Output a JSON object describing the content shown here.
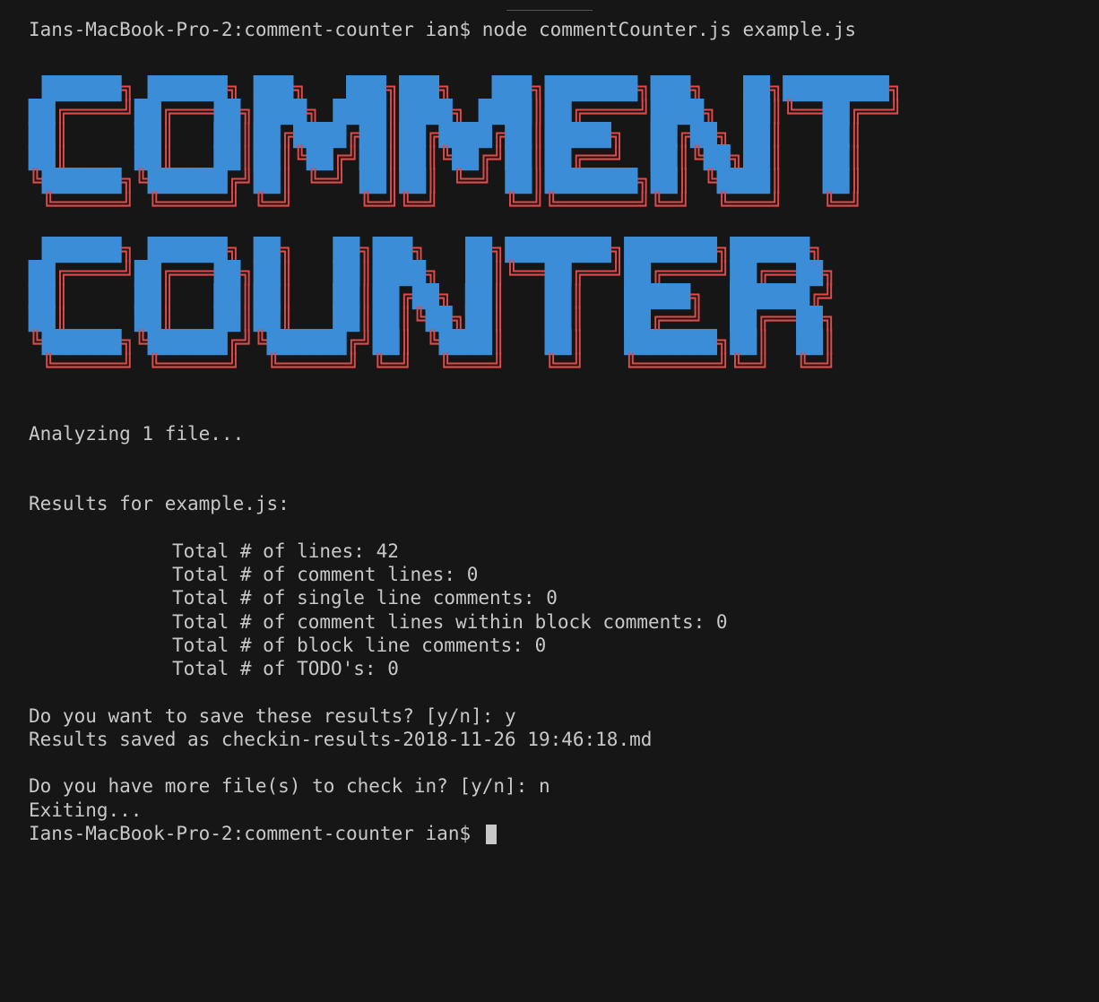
{
  "drag_handle": "window-drag-handle",
  "prompt1": {
    "host": "Ians-MacBook-Pro-2:",
    "cwd": "comment-counter",
    "user": "ian$",
    "command": "node commentCounter.js example.js"
  },
  "ascii": {
    "word1_shadow": [
      " ██████╗ ██████╗ ███╗   ███╗███╗   ███╗███████╗███╗   ██╗████████╗",
      "██╔════╝██╔═══██╗████╗ ████║████╗ ████║██╔════╝████╗  ██║╚══██╔══╝",
      "██║     ██║   ██║██╔████╔██║██╔████╔██║█████╗  ██╔██╗ ██║   ██║   ",
      "██║     ██║   ██║██║╚██╔╝██║██║╚██╔╝██║██╔══╝  ██║╚██╗██║   ██║   ",
      "╚██████╗╚██████╔╝██║ ╚═╝ ██║██║ ╚═╝ ██║███████╗██║ ╚████║   ██║   ",
      " ╚═════╝ ╚═════╝ ╚═╝     ╚═╝╚═╝     ╚═╝╚══════╝╚═╝  ╚═══╝   ╚═╝   "
    ],
    "word2_shadow": [
      " ██████╗ ██████╗ ██╗   ██╗███╗   ██╗████████╗███████╗██████╗ ",
      "██╔════╝██╔═══██╗██║   ██║████╗  ██║╚══██╔══╝██╔════╝██╔══██╗",
      "██║     ██║   ██║██║   ██║██╔██╗ ██║   ██║   █████╗  ██████╔╝",
      "██║     ██║   ██║██║   ██║██║╚██╗██║   ██║   ██╔══╝  ██╔══██╗",
      "╚██████╗╚██████╔╝╚██████╔╝██║ ╚████║   ██║   ███████╗██║  ██║",
      " ╚═════╝ ╚═════╝  ╚═════╝ ╚═╝  ╚═══╝   ╚═╝   ╚══════╝╚═╝  ╚═╝"
    ]
  },
  "analyzing": "Analyzing 1 file...",
  "results_header": "Results for example.js:",
  "stats": {
    "lines_label": "Total # of lines: ",
    "lines_value": "42",
    "comment_lines_label": "Total # of comment lines: ",
    "comment_lines_value": "0",
    "single_comments_label": "Total # of single line comments: ",
    "single_comments_value": "0",
    "block_within_label": "Total # of comment lines within block comments: ",
    "block_within_value": "0",
    "block_lines_label": "Total # of block line comments: ",
    "block_lines_value": "0",
    "todos_label": "Total # of TODO's: ",
    "todos_value": "0"
  },
  "save_prompt": {
    "question": "Do you want to save these results? [y/n]: ",
    "answer": "y"
  },
  "saved_msg": "Results saved as checkin-results-2018-11-26 19:46:18.md",
  "more_prompt": {
    "question": "Do you have more file(s) to check in? [y/n]: ",
    "answer": "n"
  },
  "exiting": "Exiting...",
  "prompt2": {
    "host": "Ians-MacBook-Pro-2:",
    "cwd": "comment-counter",
    "user": "ian$"
  }
}
